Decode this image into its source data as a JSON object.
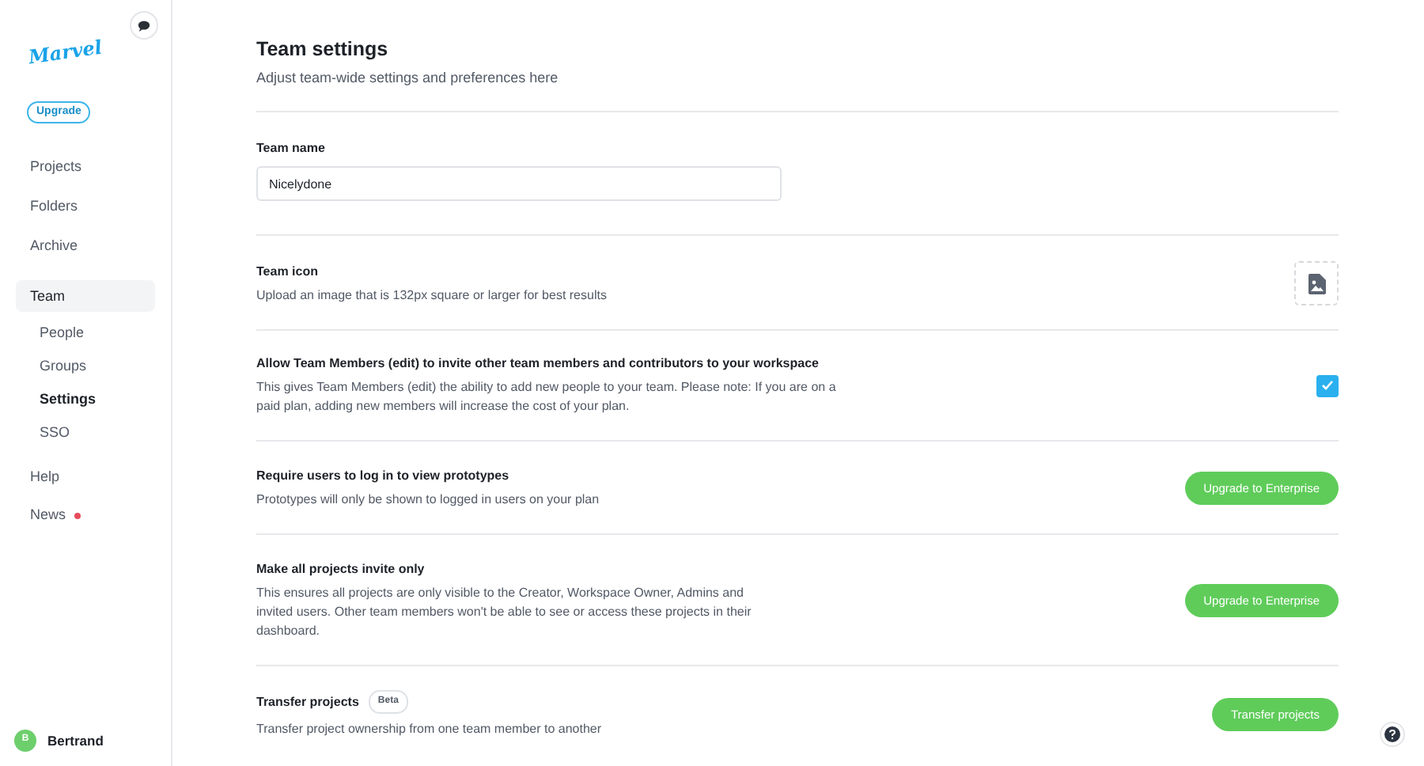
{
  "sidebar": {
    "logo": "Marvel",
    "upgrade_button": "Upgrade",
    "items": [
      {
        "label": "Projects",
        "selected": false
      },
      {
        "label": "Folders",
        "selected": false
      },
      {
        "label": "Archive",
        "selected": false
      },
      {
        "label": "Team",
        "selected": true,
        "children": [
          {
            "label": "People",
            "selected": false
          },
          {
            "label": "Groups",
            "selected": false
          },
          {
            "label": "Settings",
            "selected": true
          },
          {
            "label": "SSO",
            "selected": false
          }
        ]
      },
      {
        "label": "Help",
        "selected": false
      },
      {
        "label": "News",
        "selected": false,
        "notification": true
      }
    ],
    "user": {
      "initial": "B",
      "name": "Bertrand"
    }
  },
  "header": {
    "title": "Team settings",
    "subtitle": "Adjust team-wide settings and preferences here"
  },
  "team_name": {
    "label": "Team name",
    "value": "Nicelydone"
  },
  "settings": [
    {
      "kind": "image",
      "title": "Team icon",
      "description": "Upload an image that is 132px square or larger for best results"
    },
    {
      "kind": "checkbox",
      "title": "Allow Team Members (edit) to invite other team members and contributors to your workspace",
      "description": "This gives Team Members (edit) the ability to add new people to your team. Please note: If you are on a paid plan, adding new members will increase the cost of your plan.",
      "checked": true
    },
    {
      "kind": "button",
      "title": "Require users to log in to view prototypes",
      "description": "Prototypes will only be shown to logged in users on your plan",
      "button": "Upgrade to Enterprise"
    },
    {
      "kind": "button",
      "title": "Make all projects invite only",
      "description": "This ensures all projects are only visible to the Creator, Workspace Owner, Admins and invited users. Other team members won't be able to see or access these projects in their dashboard.",
      "button": "Upgrade to Enterprise"
    },
    {
      "kind": "button",
      "title": "Transfer projects",
      "badge": "Beta",
      "description": "Transfer project ownership from one team member to another",
      "button": "Transfer projects"
    }
  ]
}
